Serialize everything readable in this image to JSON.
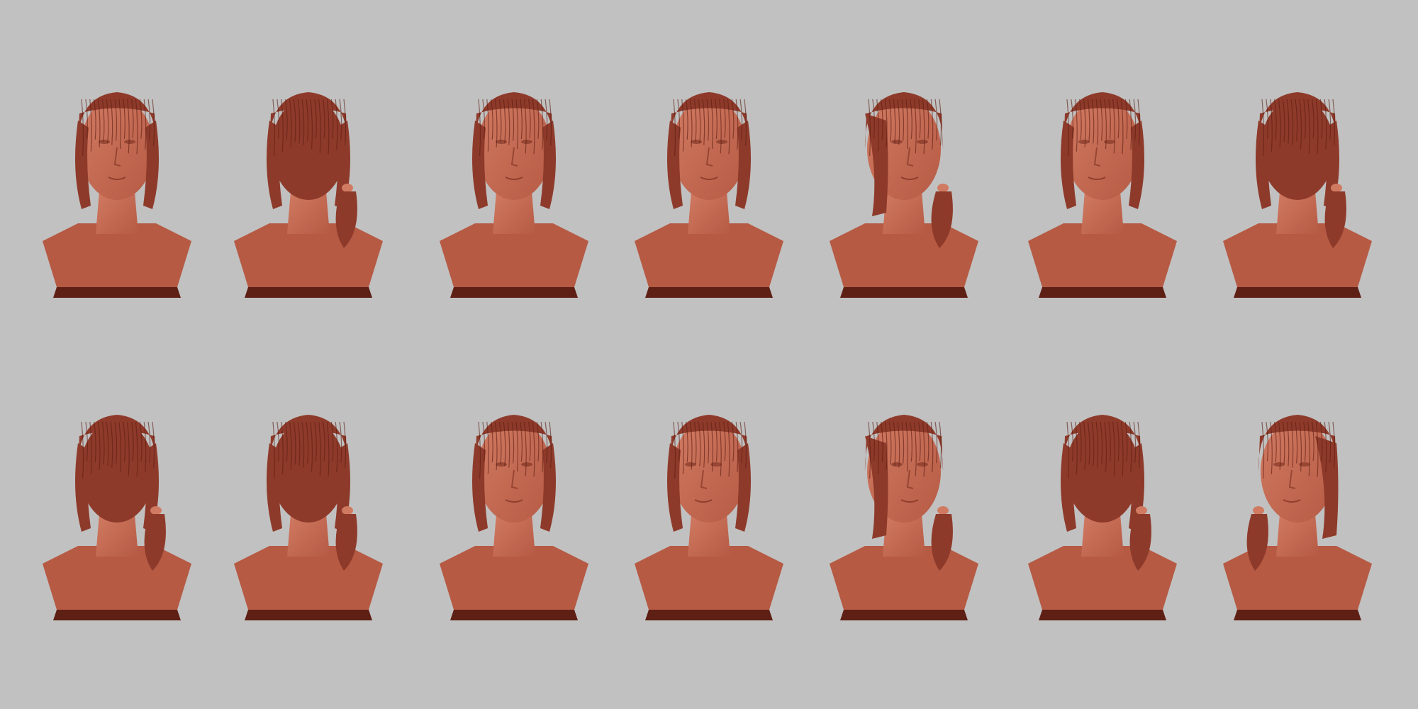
{
  "viewport": {
    "background_color": "#c1c1c1"
  },
  "colors": {
    "clay_light": "#d17a62",
    "clay_mid": "#b65a44",
    "clay_dark": "#7a2e20",
    "clay_shadow": "#5e1f15",
    "hair": "#8e3a2a",
    "hair_strand": "#5a1c12"
  },
  "rows": [
    {
      "busts": [
        {
          "view": "front"
        },
        {
          "view": "back-left-three-quarter"
        },
        {
          "view": "front"
        },
        {
          "view": "front"
        },
        {
          "view": "right-profile"
        },
        {
          "view": "left-three-quarter"
        },
        {
          "view": "back-right-three-quarter"
        }
      ]
    },
    {
      "busts": [
        {
          "view": "back-left-three-quarter"
        },
        {
          "view": "back"
        },
        {
          "view": "front-tilted-down"
        },
        {
          "view": "left-three-quarter-tilted"
        },
        {
          "view": "right-profile"
        },
        {
          "view": "back-right-three-quarter"
        },
        {
          "view": "left-profile"
        }
      ]
    }
  ]
}
